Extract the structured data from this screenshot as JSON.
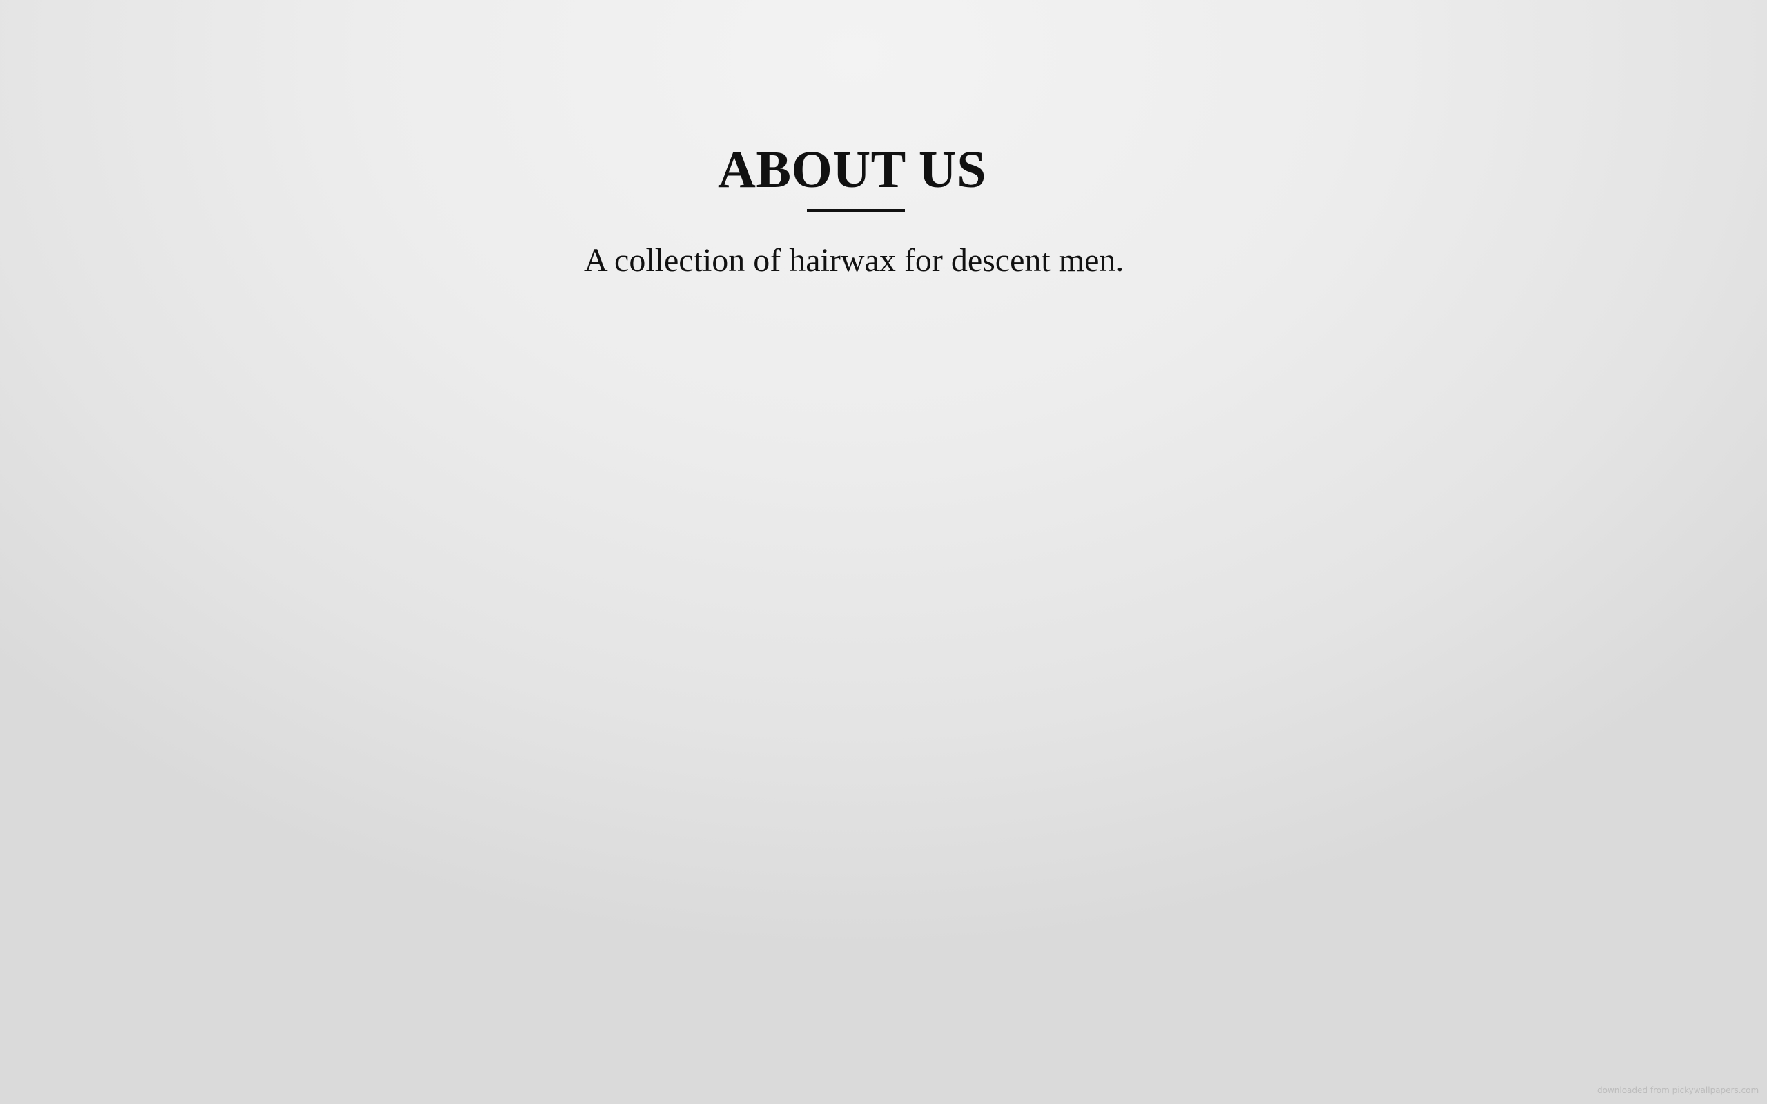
{
  "about": {
    "title": "ABOUT US",
    "description": "A collection of hairwax for descent men."
  },
  "watermark": "downloaded from pickywallpapers.com",
  "colors": {
    "text": "#111111",
    "background_light": "#f3f3f3",
    "background_dark": "#dadada",
    "watermark": "#bcbcbc"
  }
}
